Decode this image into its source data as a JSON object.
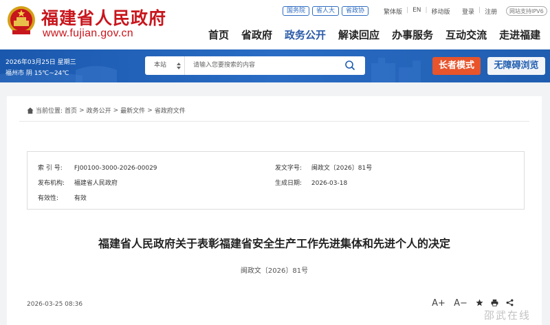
{
  "header": {
    "site_name": "福建省人民政府",
    "site_domain": "www.fujian.gov.cn",
    "top_links": [
      "国务院",
      "省人大",
      "省政协"
    ],
    "lang_links": [
      "繁体版",
      "EN",
      "移动版"
    ],
    "login": "登录",
    "register": "注册",
    "ipv6": "网站支持IPV6",
    "nav": [
      "首页",
      "省政府",
      "政务公开",
      "解读回应",
      "办事服务",
      "互动交流",
      "走进福建"
    ],
    "nav_active_index": 2
  },
  "banner": {
    "date": "2026年03月25日 星期三",
    "weather": "福州市 阴 15℃~24℃",
    "search_scope": "本站",
    "search_placeholder": "请输入您要搜索的内容",
    "elder_mode": "长者模式",
    "accessible": "无障碍浏览"
  },
  "breadcrumb": {
    "prefix": "当前位置:",
    "items": [
      "首页",
      "政务公开",
      "最新文件",
      "省政府文件"
    ],
    "separator": ">"
  },
  "meta": {
    "index_label": "索 引 号:",
    "index_value": "FJ00100-3000-2026-00029",
    "doc_no_label": "发文字号:",
    "doc_no_value": "闽政文〔2026〕81号",
    "issuer_label": "发布机构:",
    "issuer_value": "福建省人民政府",
    "date_label": "生成日期:",
    "date_value": "2026-03-18",
    "validity_label": "有效性:",
    "validity_value": "有效"
  },
  "document": {
    "title": "福建省人民政府关于表彰福建省安全生产工作先进集体和先进个人的决定",
    "number": "闽政文〔2026〕81号",
    "publish_time": "2026-03-25 08:36"
  },
  "tools": {
    "font_up": "A+",
    "font_down": "A−"
  },
  "watermark": "邵武在线",
  "colors": {
    "brand_red": "#c8161d",
    "banner_blue": "#1f5db0",
    "nav_active": "#2a5aa8",
    "elder_orange": "#e8542c"
  }
}
